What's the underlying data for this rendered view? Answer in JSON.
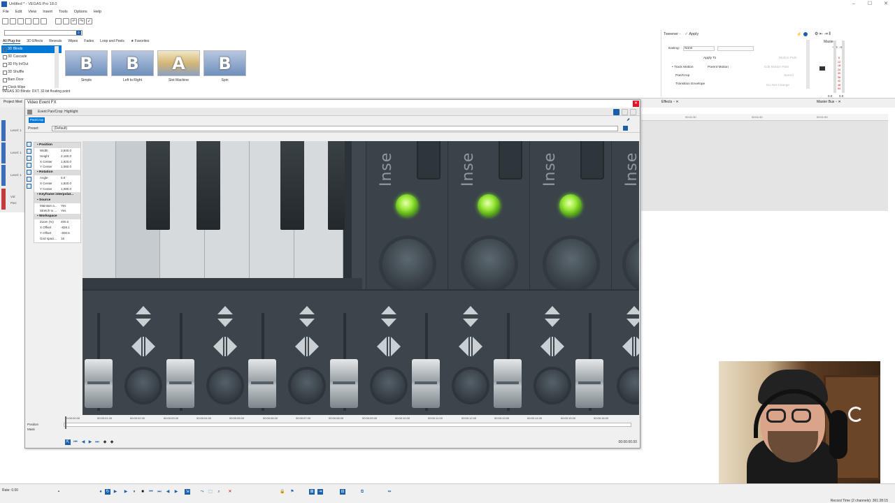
{
  "window": {
    "title": "Untitled * - VEGAS Pro 18.0"
  },
  "menu": [
    "File",
    "Edit",
    "View",
    "Insert",
    "Tools",
    "Options",
    "Help"
  ],
  "plugins": {
    "tabs": [
      "All Plug-Ins",
      "3D Effects",
      "Reveals",
      "Wipes",
      "Fades",
      "Loop and Peels",
      "★ Favorites"
    ],
    "list": [
      "3D Blinds",
      "3D Cascade",
      "3D Fly In/Out",
      "3D Shuffle",
      "Barn Door",
      "Clock Wipe"
    ],
    "presets": [
      "Simple",
      "Left to Right",
      "Slot Machine",
      "Spin"
    ],
    "status": "VEGAS 3D Blinds: DXT, 32-bit floating point"
  },
  "tweener": {
    "title": "Tweener -",
    "apply": "Apply",
    "easing_label": "Easing:",
    "easing_value": "None",
    "apply_to": "Apply To",
    "track_motion": "Track Motion",
    "parent_motion": "Parent Motion",
    "pan_crop": "Pan/Crop",
    "transition_envelope": "Transition Envelope",
    "motion_path": "Motion Path",
    "edit_motion_path": "Edit Motion Path",
    "speed": "Speed",
    "do_not_change": "Do Not Change"
  },
  "master_bus": {
    "title": "Master",
    "scale": [
      "6",
      "12",
      "18",
      "24",
      "30",
      "36",
      "42",
      "48",
      "54"
    ],
    "peak_left": "-5.4",
    "peak_right": "-4.9",
    "bottom_left": "0.0",
    "bottom_right": "0.0"
  },
  "dock": {
    "project_media": "Project Med",
    "effects": "Effects",
    "master_bus": "Master Bus"
  },
  "tracks": {
    "levels": [
      "Level: 1",
      "Level: 1",
      "Level: 1"
    ],
    "vol": "Vol:",
    "pan": "Pan:"
  },
  "timeline": {
    "ticks": [
      "00:01:30",
      "00:01:40",
      "00:01:50"
    ]
  },
  "vefx": {
    "window_title": "Video Event FX",
    "chain_label": "Event Pan/Crop: Highlight",
    "fx_chip": "Pan/Crop",
    "preset_label": "Preset:",
    "preset_value": "(Default)",
    "sections": {
      "position": "Position",
      "rotation": "Rotation",
      "keyframe": "Keyframe interpolat...",
      "source": "Source",
      "workspace": "Workspace"
    },
    "position": [
      {
        "k": "Width",
        "v": "3,840.0"
      },
      {
        "k": "Height",
        "v": "2,160.0"
      },
      {
        "k": "X Center",
        "v": "1,920.0"
      },
      {
        "k": "Y Center",
        "v": "1,080.0"
      }
    ],
    "rotation": [
      {
        "k": "Angle",
        "v": "0.0"
      },
      {
        "k": "X Center",
        "v": "1,920.0"
      },
      {
        "k": "Y Center",
        "v": "1,080.0"
      }
    ],
    "source": [
      {
        "k": "Maintain a...",
        "v": "Yes"
      },
      {
        "k": "Stretch to ...",
        "v": "Yes"
      }
    ],
    "workspace": [
      {
        "k": "Zoom (%)",
        "v": "400.0"
      },
      {
        "k": "X Offset",
        "v": "-828.1"
      },
      {
        "k": "Y Offset",
        "v": "-500.5"
      },
      {
        "k": "Grid spaci...",
        "v": "16"
      }
    ],
    "keyframe_rows": [
      "Position",
      "Mask"
    ],
    "kf_ticks": [
      "00:00:00.00",
      "00:00:01.00",
      "00:00:02.00",
      "00:00:03.00",
      "00:00:04.00",
      "00:00:05.00",
      "00:00:06.00",
      "00:00:07.00",
      "00:00:08.00",
      "00:00:09.00",
      "00:00:10.00",
      "00:00:11.00",
      "00:00:12.00",
      "00:00:13.00",
      "00:00:14.00",
      "00:00:15.00",
      "00:00:16.00"
    ],
    "kf_time": "00:00:00.00",
    "canvas_text": "Inse"
  },
  "transport": {
    "rate": "Rate: 0.00",
    "record_time": "Record Time (2 channels): 361:28:15"
  }
}
